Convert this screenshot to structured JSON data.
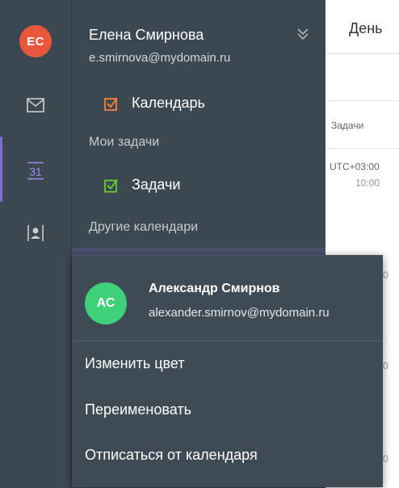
{
  "colors": {
    "sidebar_bg": "#3b4751",
    "popup_bg": "#3e4a54",
    "user_avatar": "#e8563c",
    "owner_avatar": "#3fd07a",
    "calendar_check": "#f4823a",
    "tasks_check": "#66cc2e",
    "active_accent": "#7d6bd6"
  },
  "rail": {
    "avatar_initials": "ЕС",
    "icons": [
      "mail-icon",
      "calendar-icon",
      "contacts-icon"
    ],
    "calendar_day": "31"
  },
  "account": {
    "name": "Елена Смирнова",
    "email": "e.smirnova@mydomain.ru"
  },
  "calendars": {
    "my_calendar": "Календарь",
    "my_tasks_header": "Мои задачи",
    "tasks_item": "Задачи",
    "other_header": "Другие календари"
  },
  "calendar_view": {
    "view_label": "День",
    "tasks_label": "Задачи",
    "timezone": "UTC+03:00",
    "time_fragment": "10:00",
    "edge_fragments": [
      "0",
      "0",
      "0",
      "0"
    ]
  },
  "popup": {
    "avatar_initials": "АС",
    "owner_name": "Александр Смирнов",
    "owner_email": "alexander.smirnov@mydomain.ru",
    "menu": [
      "Изменить цвет",
      "Переименовать",
      "Отписаться от календаря"
    ]
  }
}
